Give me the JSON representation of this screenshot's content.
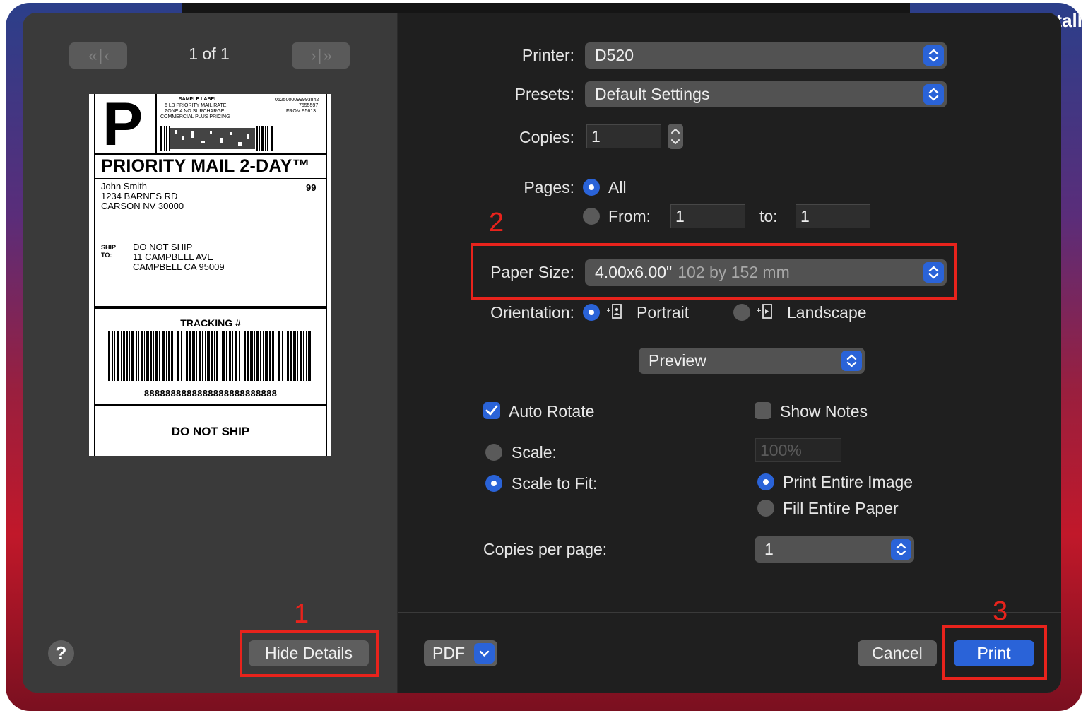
{
  "background": {
    "corner_text": "tall"
  },
  "preview": {
    "page_counter": "1 of 1",
    "label": {
      "big_letter": "P",
      "sample_title": "SAMPLE LABEL",
      "rate_lines": [
        "6 LB PRIORITY MAIL RATE",
        "ZONE 4 NO SURCHARGE",
        "COMMERCIAL PLUS PRICING"
      ],
      "right_small": [
        "0625000099993842",
        "7555597",
        "FROM 95613"
      ],
      "service": "PRIORITY MAIL 2-DAY™",
      "sender": [
        "John Smith",
        "1234 BARNES RD",
        "CARSON NV 30000"
      ],
      "route": "99",
      "ship_to_label": "SHIP TO:",
      "recipient": [
        "DO NOT SHIP",
        "11 CAMPBELL AVE",
        "CAMPBELL CA 95009"
      ],
      "tracking_title": "TRACKING #",
      "tracking_number": "8888888888888888888888888",
      "footer": "DO NOT SHIP"
    }
  },
  "left_footer": {
    "help": "?",
    "hide_details": "Hide Details"
  },
  "form": {
    "printer_label": "Printer:",
    "printer_value": "D520",
    "presets_label": "Presets:",
    "presets_value": "Default Settings",
    "copies_label": "Copies:",
    "copies_value": "1",
    "pages_label": "Pages:",
    "pages_all": "All",
    "pages_from": "From:",
    "pages_from_value": "1",
    "pages_to": "to:",
    "pages_to_value": "1",
    "paper_label": "Paper Size:",
    "paper_value": "4.00x6.00\"",
    "paper_detail": "102 by 152 mm",
    "orientation_label": "Orientation:",
    "portrait": "Portrait",
    "landscape": "Landscape",
    "section_popup": "Preview",
    "auto_rotate": "Auto Rotate",
    "show_notes": "Show Notes",
    "scale": "Scale:",
    "scale_value": "100%",
    "scale_to_fit": "Scale to Fit:",
    "print_entire": "Print Entire Image",
    "fill_entire": "Fill Entire Paper",
    "copies_per_page_label": "Copies per page:",
    "copies_per_page_value": "1"
  },
  "right_footer": {
    "pdf": "PDF",
    "cancel": "Cancel",
    "print": "Print"
  },
  "annotations": [
    "1",
    "2",
    "3"
  ],
  "colors": {
    "accent": "#2a63d8",
    "highlight": "#e8231c"
  }
}
